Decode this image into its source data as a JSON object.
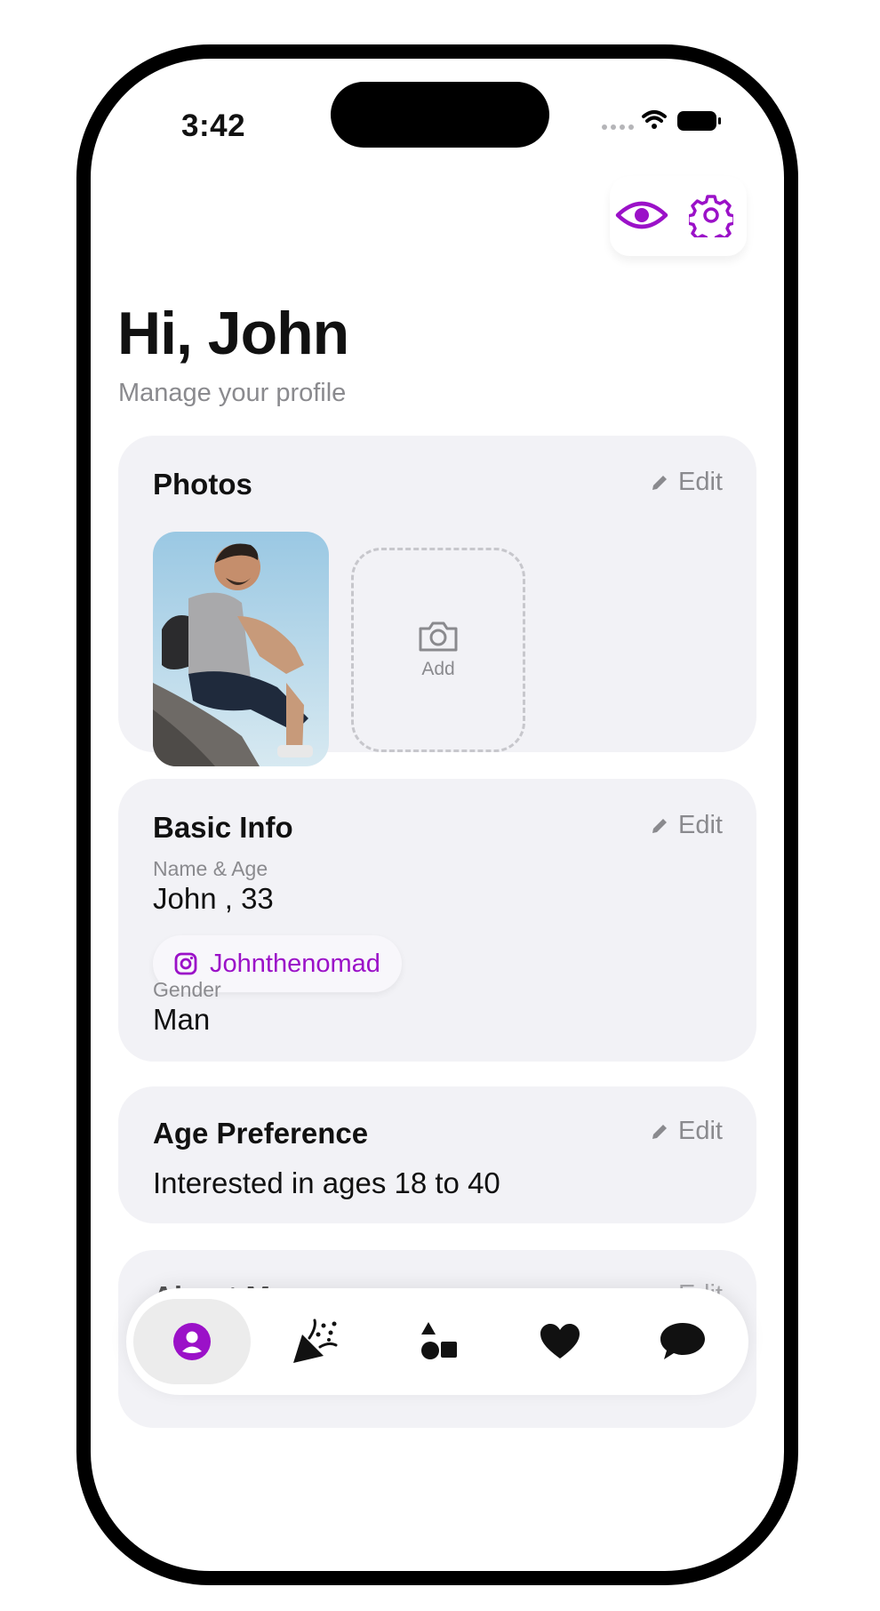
{
  "status_bar": {
    "time": "3:42"
  },
  "header": {
    "greeting": "Hi, John",
    "subtitle": "Manage your profile",
    "preview_icon": "eye-icon",
    "settings_icon": "gear-icon"
  },
  "photos_card": {
    "title": "Photos",
    "edit_label": "Edit",
    "add_label": "Add"
  },
  "basic_info_card": {
    "title": "Basic Info",
    "edit_label": "Edit",
    "name_age_label": "Name & Age",
    "name_age_value": "John  , 33",
    "instagram_handle": "Johnthenomad",
    "gender_label": "Gender",
    "gender_value": "Man"
  },
  "age_pref_card": {
    "title": "Age Preference",
    "edit_label": "Edit",
    "value": "Interested in ages 18 to 40"
  },
  "about_card": {
    "title": "About Me",
    "edit_label": "Edit"
  },
  "tab_bar": {
    "tabs": [
      {
        "icon": "profile-icon",
        "active": true
      },
      {
        "icon": "party-popper-icon",
        "active": false
      },
      {
        "icon": "shapes-icon",
        "active": false
      },
      {
        "icon": "heart-icon",
        "active": false
      },
      {
        "icon": "chat-bubble-icon",
        "active": false
      }
    ]
  },
  "colors": {
    "accent": "#9b11c8",
    "card_bg": "#f2f2f6",
    "muted_text": "#8a8a8e"
  }
}
